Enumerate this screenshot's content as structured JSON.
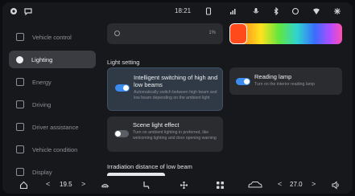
{
  "status": {
    "time": "18:21",
    "left_icons": [
      "power-icon",
      "chat-icon"
    ],
    "right_icons": [
      "phone-icon",
      "signal-icon",
      "mic-icon",
      "bluetooth-icon",
      "mobile-data-icon",
      "wifi-icon",
      "settings-icon"
    ]
  },
  "sidebar": {
    "items": [
      {
        "label": "Vehicle control",
        "icon": "car-icon",
        "active": false
      },
      {
        "label": "Lighting",
        "icon": "light-icon",
        "active": true
      },
      {
        "label": "Energy",
        "icon": "energy-icon",
        "active": false
      },
      {
        "label": "Driving",
        "icon": "steering-icon",
        "active": false
      },
      {
        "label": "Driver assistance",
        "icon": "assist-icon",
        "active": false
      },
      {
        "label": "Vehicle condition",
        "icon": "condition-icon",
        "active": false
      },
      {
        "label": "Display",
        "icon": "display-icon",
        "active": false
      }
    ]
  },
  "main": {
    "search_value": "1%",
    "ambient_color": "#ff4a1c",
    "section_title": "Light setting",
    "cards": {
      "smart_beam": {
        "title": "Intelligent switching of high and low beams",
        "desc": "Automatically switch between high beam and low beam depending on the ambient light",
        "enabled": true
      },
      "reading_lamp": {
        "title": "Reading lamp",
        "desc": "Turn on the interior reading lamp",
        "enabled": true
      },
      "scene_light": {
        "title": "Scene light effect",
        "desc": "Turn on ambient lighting in preferred, like welcoming lighting and door opening warning",
        "enabled": false
      }
    },
    "beam_title": "Irradiation distance of low beam"
  },
  "dock": {
    "left_temp": "19.5",
    "right_temp": "27.0",
    "arrow_left": "<",
    "arrow_right": ">",
    "icons": [
      "home-icon",
      "defrost-icon",
      "seat-heat-icon",
      "fan-icon",
      "apps-icon",
      "car-icon",
      "volume-icon"
    ]
  },
  "colors": {
    "accent": "#3b8cf0",
    "background": "#17181b",
    "card": "#2a2c30"
  }
}
